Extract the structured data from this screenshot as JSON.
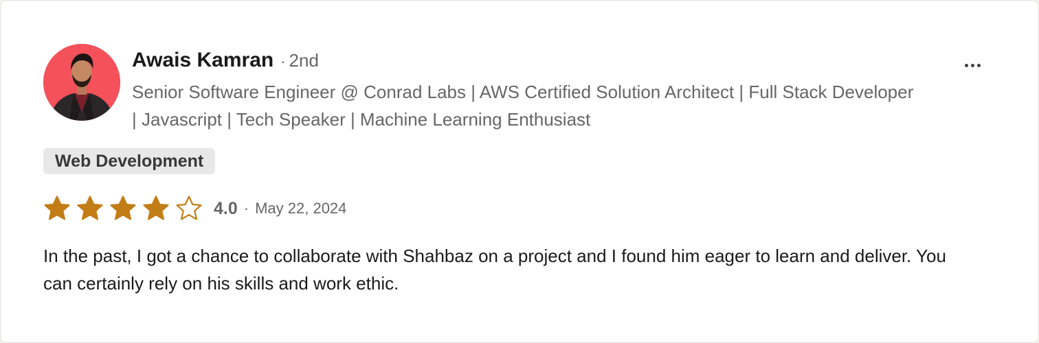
{
  "reviewer": {
    "name": "Awais Kamran",
    "degree_separator": "·",
    "degree": "2nd",
    "headline": "Senior Software Engineer @ Conrad Labs | AWS Certified Solution Architect | Full Stack Developer | Javascript | Tech Speaker | Machine Learning Enthusiast",
    "avatar_icon": "profile-photo"
  },
  "more_button": {
    "icon": "more-horizontal-icon"
  },
  "skill": {
    "label": "Web Development"
  },
  "rating": {
    "stars_filled": 4,
    "stars_total": 5,
    "value": "4.0",
    "separator": "·",
    "date": "May 22, 2024",
    "star_color": "#c37d16"
  },
  "review": {
    "text": "In the past, I got a chance to collaborate with Shahbaz on a project and I found him eager to learn and deliver. You can certainly rely on his skills and work ethic."
  }
}
